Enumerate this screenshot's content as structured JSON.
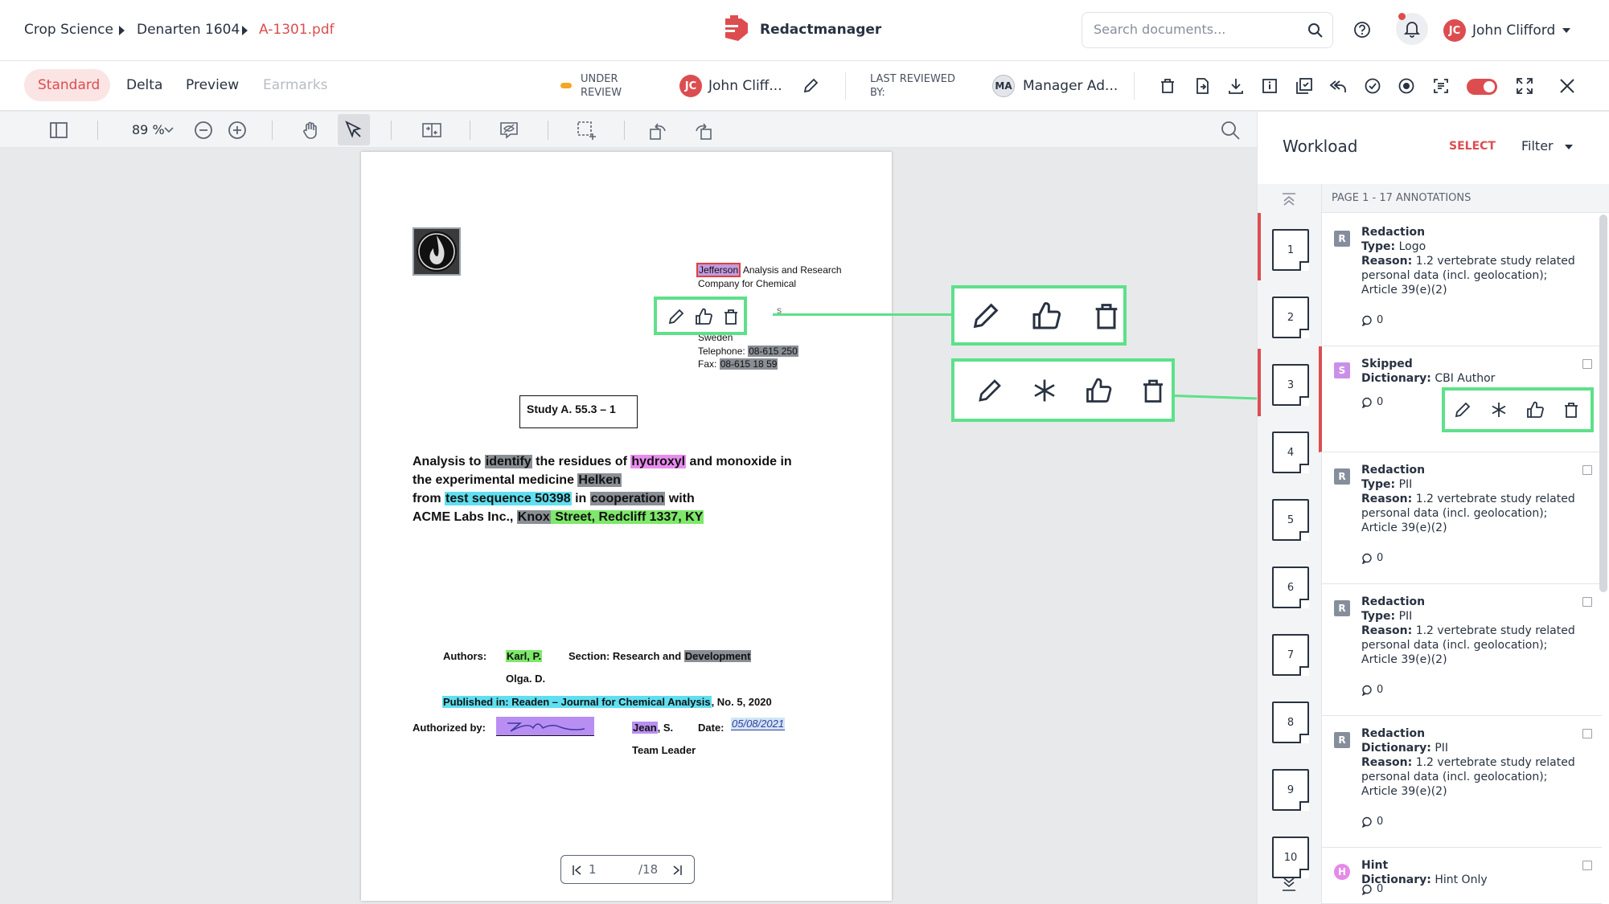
{
  "breadcrumb": [
    "Crop Science",
    "Denarten 1604",
    "A-1301.pdf"
  ],
  "app": {
    "name": "Redactmanager",
    "brand_color": "#dd4d50"
  },
  "search": {
    "placeholder": "Search documents..."
  },
  "user": {
    "initials": "JC",
    "name": "John Clifford"
  },
  "tabs": [
    "Standard",
    "Delta",
    "Preview",
    "Earmarks"
  ],
  "status": {
    "line1": "UNDER",
    "line2": "REVIEW",
    "color": "#f5a623"
  },
  "assignee": {
    "initials": "JC",
    "name": "John Cliff..."
  },
  "last_reviewed": {
    "line1": "LAST REVIEWED",
    "line2": "BY:",
    "initials": "MA",
    "name": "Manager Ad..."
  },
  "viewer": {
    "zoom": "89 %"
  },
  "document": {
    "company": [
      "Jefferson",
      "Analysis and Research",
      "Company for Chemical"
    ],
    "address": [
      "s",
      "Sweden"
    ],
    "telephone_label": "Telephone:",
    "telephone": "08-615 250",
    "fax_label": "Fax:",
    "fax": "08-615 18 59",
    "study": "Study A. 55.3 – 1",
    "title_lines": [
      [
        "Analysis to ",
        "identify",
        " the residues of ",
        "hydroxyl",
        " and monoxide in"
      ],
      [
        "the experimental medicine ",
        "Helken"
      ],
      [
        "from ",
        "test sequence 50398",
        " in ",
        "cooperation",
        " with"
      ],
      [
        "ACME Labs Inc., ",
        "Knox",
        " Street, Redcliff 1337, KY"
      ]
    ],
    "authors_label": "Authors:",
    "author1": "Karl, P.",
    "author2": "Olga. D.",
    "section": "Section: Research and ",
    "section_hl": "Development",
    "published_hl": "Published in: Readen – Journal for Chemical Analysis",
    "published_rest": ", No. 5, 2020",
    "authorized_label": "Authorized by:",
    "signer": "Jean",
    "signer_rest": ", S.",
    "date_label": "Date:",
    "date_value": "05/08/2021",
    "team_leader": "Team Leader",
    "page_current": "1",
    "page_total": "/18"
  },
  "panel": {
    "title": "Workload",
    "select_label": "SELECT",
    "filter_label": "Filter",
    "page_header": "PAGE 1 - 17 ANNOTATIONS",
    "pages": [
      "1",
      "2",
      "3",
      "4",
      "5",
      "6",
      "7",
      "8",
      "9",
      "10"
    ],
    "annotations": [
      {
        "badge": "R",
        "title": "Redaction",
        "k1": "Type:",
        "v1": "Logo",
        "k2": "Reason:",
        "v2": "1.2 vertebrate study related personal data (incl. geolocation); Article 39(e)(2)",
        "comments": "0"
      },
      {
        "badge": "S",
        "title": "Skipped",
        "k1": "Dictionary:",
        "v1": "CBI Author",
        "comments": "0"
      },
      {
        "badge": "R",
        "title": "Redaction",
        "k1": "Type:",
        "v1": "PII",
        "k2": "Reason:",
        "v2": "1.2 vertebrate study related personal data (incl. geolocation); Article 39(e)(2)",
        "comments": "0"
      },
      {
        "badge": "R",
        "title": "Redaction",
        "k1": "Type:",
        "v1": "PII",
        "k2": "Reason:",
        "v2": "1.2 vertebrate study related personal data (incl. geolocation); Article 39(e)(2)",
        "comments": "0"
      },
      {
        "badge": "R",
        "title": "Redaction",
        "k1": "Dictionary:",
        "v1": "PII",
        "k2": "Reason:",
        "v2": "1.2 vertebrate study related personal data (incl. geolocation); Article 39(e)(2)",
        "comments": "0"
      },
      {
        "badge": "H",
        "title": "Hint",
        "k1": "Dictionary:",
        "v1": "Hint Only",
        "comments": "0"
      }
    ]
  },
  "colors": {
    "highlight_green": "#5ee08a",
    "hl_gray": "#8a8f96",
    "hl_pink": "#e98cf0",
    "hl_cyan": "#5fdff0",
    "hl_lime": "#7ee86a",
    "hl_purple": "#b98ef2"
  }
}
